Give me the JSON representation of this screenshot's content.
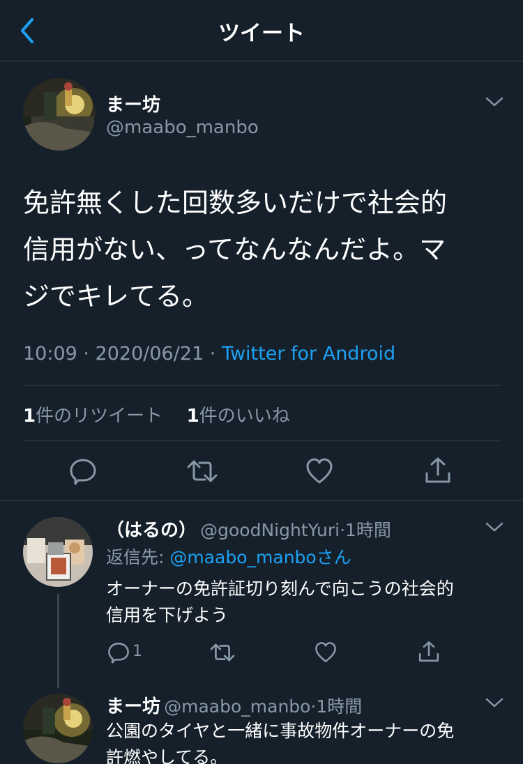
{
  "header": {
    "title": "ツイート"
  },
  "tweet": {
    "name": "まー坊",
    "handle": "@maabo_manbo",
    "text_lines": [
      "免許無くした回数多いだけで社会的",
      "信用がない、ってなんなんだよ。マ",
      "ジでキレてる。"
    ],
    "time": "10:09 · 2020/06/21 · ",
    "source": "Twitter for Android",
    "retweet_count": "1",
    "retweet_label": "件のリツイート",
    "like_count": "1",
    "like_label": "件のいいね"
  },
  "replies": [
    {
      "name": "（はるの）",
      "handle": "@goodNightYuri",
      "time": "·1時間",
      "replying_label": "返信先: ",
      "replying_to": "@maabo_manbo",
      "replying_suffix": "さん",
      "text_lines": [
        "オーナーの免許証切り刻んで向こうの社会的",
        "信用を下げよう"
      ],
      "reply_count": "1"
    },
    {
      "name": "まー坊",
      "handle": "@maabo_manbo",
      "time": "·1時間",
      "text_lines": [
        "公園のタイヤと一緒に事故物件オーナーの免",
        "許燃やしてる。"
      ]
    }
  ],
  "icons": {
    "back": "chevron-left-icon",
    "reply": "reply-icon",
    "retweet": "retweet-icon",
    "like": "heart-icon",
    "share": "share-icon",
    "more": "chevron-down-icon"
  },
  "colors": {
    "background": "#15202b",
    "accent": "#1da1f2",
    "muted": "#8899a6",
    "divider": "#38444d"
  }
}
